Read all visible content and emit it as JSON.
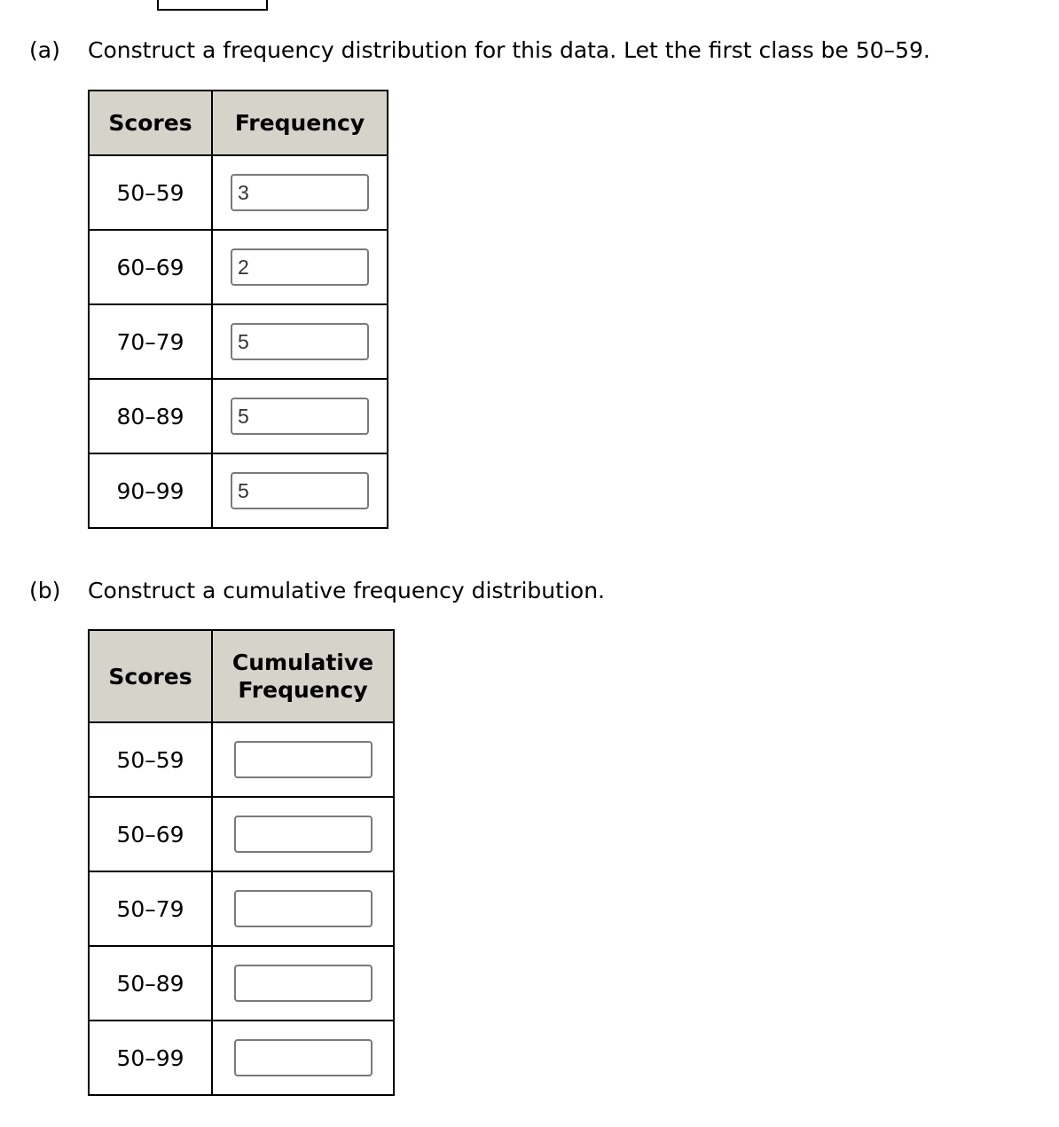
{
  "part_a": {
    "label": "(a)",
    "prompt": "Construct a frequency distribution for this data. Let the first class be 50–59.",
    "table": {
      "headers": [
        "Scores",
        "Frequency"
      ],
      "rows": [
        {
          "class": "50–59",
          "value": "3"
        },
        {
          "class": "60–69",
          "value": "2"
        },
        {
          "class": "70–79",
          "value": "5"
        },
        {
          "class": "80–89",
          "value": "5"
        },
        {
          "class": "90–99",
          "value": "5"
        }
      ]
    }
  },
  "part_b": {
    "label": "(b)",
    "prompt": "Construct a cumulative frequency distribution.",
    "table": {
      "headers": [
        "Scores",
        "Cumulative",
        "Frequency"
      ],
      "rows": [
        {
          "class": "50–59",
          "value": ""
        },
        {
          "class": "50–69",
          "value": ""
        },
        {
          "class": "50–79",
          "value": ""
        },
        {
          "class": "50–89",
          "value": ""
        },
        {
          "class": "50–99",
          "value": ""
        }
      ]
    }
  }
}
